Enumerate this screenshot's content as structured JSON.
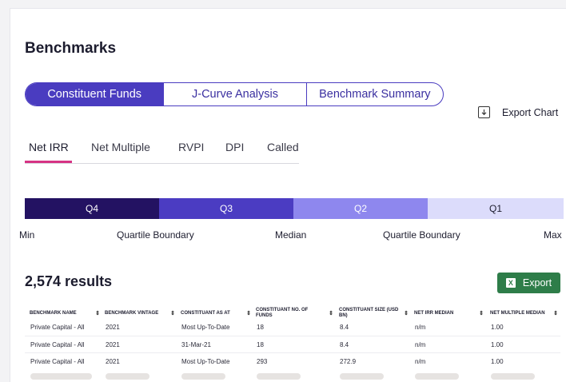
{
  "page": {
    "title": "Benchmarks"
  },
  "view_tabs": [
    {
      "label": "Constituent Funds",
      "active": true
    },
    {
      "label": "J-Curve Analysis",
      "active": false
    },
    {
      "label": "Benchmark Summary",
      "active": false
    }
  ],
  "export_chart": {
    "label": "Export Chart",
    "icon": "download-icon"
  },
  "metric_tabs": [
    {
      "label": "Net IRR",
      "active": true
    },
    {
      "label": "Net Multiple",
      "active": false
    },
    {
      "label": "RVPI",
      "active": false
    },
    {
      "label": "DPI",
      "active": false
    },
    {
      "label": "Called",
      "active": false
    }
  ],
  "quartiles": {
    "segments": [
      {
        "label": "Q4",
        "color": "#231262"
      },
      {
        "label": "Q3",
        "color": "#4b3cc2"
      },
      {
        "label": "Q2",
        "color": "#8e87ee"
      },
      {
        "label": "Q1",
        "color": "#dcdcfb"
      }
    ],
    "scale_labels": [
      "Min",
      "Quartile Boundary",
      "Median",
      "Quartile Boundary",
      "Max"
    ]
  },
  "results": {
    "count_text": "2,574 results"
  },
  "export_button": {
    "label": "Export",
    "icon": "excel-icon",
    "icon_glyph": "X",
    "color": "#2e7d49"
  },
  "table": {
    "columns": [
      "BENCHMARK NAME",
      "BENCHMARK VINTAGE",
      "CONSTITUANT AS AT",
      "CONSTITUANT NO. OF FUNDS",
      "CONSTITUANT SIZE (USD BN)",
      "NET IRR MEDIAN",
      "NET MULTIPLE MEDIAN"
    ],
    "sort_glyph": "⇕",
    "rows": [
      [
        "Private Capital - All",
        "2021",
        "Most Up-To-Date",
        "18",
        "8.4",
        "n/m",
        "1.00"
      ],
      [
        "Private Capital - All",
        "2021",
        "31-Mar-21",
        "18",
        "8.4",
        "n/m",
        "1.00"
      ],
      [
        "Private Capital - All",
        "2021",
        "Most Up-To-Date",
        "293",
        "272.9",
        "n/m",
        "1.00"
      ]
    ]
  }
}
